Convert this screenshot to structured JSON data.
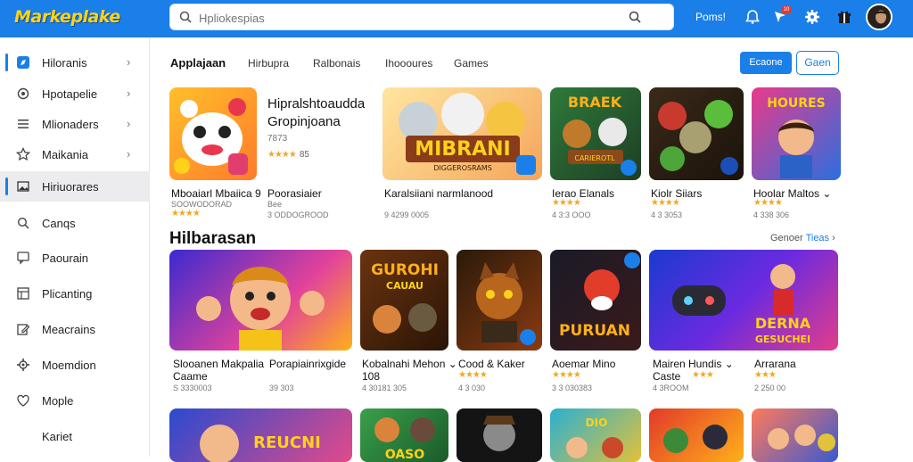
{
  "header": {
    "logo": "Markeplake",
    "search_placeholder": "Hpliokespias",
    "user_text": "Poms!",
    "badge": "10",
    "icons": [
      "search-icon",
      "bell-icon",
      "flag-icon",
      "settings-icon",
      "gift-icon"
    ]
  },
  "sidebar": {
    "items": [
      {
        "label": "Hiloranis",
        "icon": "compass-icon",
        "chevron": true
      },
      {
        "label": "Hpotapelie",
        "icon": "target-icon",
        "chevron": true
      },
      {
        "label": "Mlionaders",
        "icon": "list-icon",
        "chevron": true
      },
      {
        "label": "Maikania",
        "icon": "star-icon",
        "chevron": true
      },
      {
        "label": "Hiriuorares",
        "icon": "image-icon",
        "chevron": false,
        "active": true
      },
      {
        "label": "Canqs",
        "icon": "search-icon",
        "chevron": false
      },
      {
        "label": "Paourain",
        "icon": "chat-icon",
        "chevron": false
      },
      {
        "label": "Plicanting",
        "icon": "grid-icon",
        "chevron": false
      },
      {
        "label": "Meacrains",
        "icon": "pen-icon",
        "chevron": false
      },
      {
        "label": "Moemdion",
        "icon": "gear-icon",
        "chevron": false
      },
      {
        "label": "Mople",
        "icon": "heart-icon",
        "chevron": false
      },
      {
        "label": "Kariet",
        "icon": "",
        "chevron": false
      }
    ]
  },
  "tabs": [
    "Applajaan",
    "Hirbupra",
    "Ralbonais",
    "Ihoooures",
    "Games"
  ],
  "actions": {
    "primary": "Ecaone",
    "secondary": "Gaen"
  },
  "row1": [
    {
      "title": "Hipralshtoaudda",
      "subtitle": "Gropinjoana",
      "sub2": "7873",
      "rating": "85",
      "name": "Mboaiarl Mbaiica",
      "extra": "9",
      "stars": "★★★★",
      "meta": "SOOWODORAD",
      "name2": "Poorasiaier",
      "meta2": "Bee",
      "meta3": "3 ODDOGROOD"
    },
    {
      "title": "Karalsiiani narmlanood",
      "stars": "",
      "meta": "9 4299 0005",
      "name": "MIBRANI",
      "banner": "DIGGEROSRAMS"
    },
    {
      "title": "Ierao Elanals",
      "stars": "★★★★",
      "meta": "4 3:3 OOO",
      "name": "BRAEK",
      "banner": "CARIEROTL"
    },
    {
      "title": "Kiolr Siiars",
      "stars": "★★★★",
      "meta": "4 3 3053",
      "name": ""
    },
    {
      "title": "Hoolar Maltos",
      "stars": "★★★★",
      "meta": "4 338 306",
      "name": "HOURES"
    }
  ],
  "section": {
    "title": "Hilbarasan",
    "see_all": "Genoer",
    "see_all_link": "Tieas"
  },
  "row2": [
    {
      "title": "Slooanen Makpalia",
      "sub": "Caame",
      "stars": "",
      "meta": "S 3330003",
      "name2": "Porapiainrixgide",
      "meta2": "39 303"
    },
    {
      "title": "Kobalnahi Mehon",
      "sub": "108",
      "stars": "",
      "meta": "4 30181 305",
      "name": "GUROHI",
      "banner": "CAUAU"
    },
    {
      "title": "Cood & Kaker",
      "stars": "★★★★",
      "meta": "4 3 030",
      "name": ""
    },
    {
      "title": "Aoemar Mino",
      "stars": "★★★★",
      "meta": "3 3 030383",
      "name": "PURUAN"
    },
    {
      "title": "Mairen Hundis",
      "sub": "Caste",
      "stars": "★★★",
      "meta": "4 3ROOM",
      "name": "DERNA",
      "banner": "GESUCHEI"
    },
    {
      "title": "Arrarana",
      "stars": "★★★",
      "meta": "2 250 00",
      "name": ""
    }
  ],
  "row3": [
    {
      "name": "REUCNI"
    },
    {
      "name": "OASO"
    },
    {
      "name": ""
    },
    {
      "name": "DIO"
    },
    {
      "name": ""
    },
    {
      "name": ""
    }
  ],
  "colors": {
    "brand": "#1a7fe8",
    "star": "#f5a623",
    "logo": "#ffd21a"
  }
}
